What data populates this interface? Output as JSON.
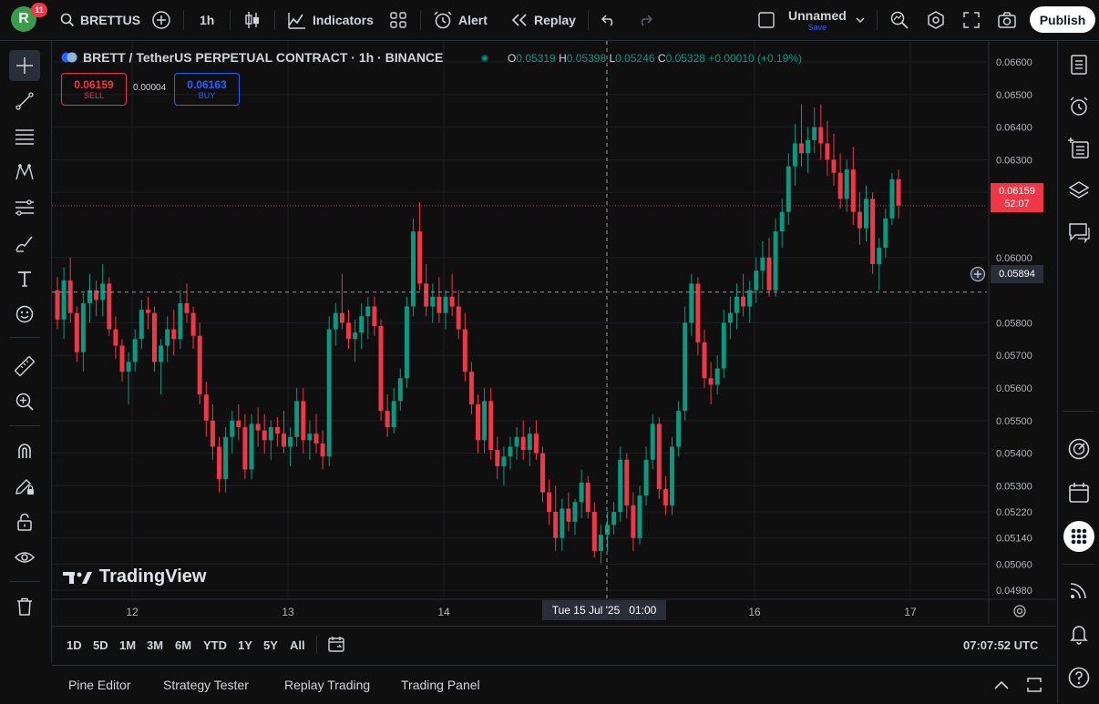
{
  "topbar": {
    "avatar_letter": "R",
    "notifications": "11",
    "symbol": "BRETTUS",
    "interval": "1h",
    "indicators_label": "Indicators",
    "alert_label": "Alert",
    "replay_label": "Replay",
    "layout_name": "Unnamed",
    "layout_status": "Save",
    "publish_label": "Publish"
  },
  "legend": {
    "title": "BRETT / TetherUS PERPETUAL CONTRACT · 1h · BINANCE",
    "o_label": "O",
    "o": "0.05319",
    "h_label": "H",
    "h": "0.05398",
    "l_label": "L",
    "l": "0.05246",
    "c_label": "C",
    "c": "0.05328",
    "change": "+0.00010 (+0.19%)"
  },
  "trade": {
    "sell_price": "0.06159",
    "sell_label": "SELL",
    "spread": "0.00004",
    "buy_price": "0.06163",
    "buy_label": "BUY"
  },
  "price_axis": {
    "ticks": [
      "0.06600",
      "0.06500",
      "0.06400",
      "0.06300",
      "0.06200",
      "0.06000",
      "0.05800",
      "0.05700",
      "0.05600",
      "0.05500",
      "0.05400",
      "0.05300",
      "0.05220",
      "0.05140",
      "0.05060",
      "0.04980"
    ],
    "last_price": "0.06159",
    "countdown": "52:07",
    "crosshair_price": "0.05894"
  },
  "time_axis": {
    "ticks": [
      "12",
      "13",
      "14",
      "16",
      "17"
    ],
    "crosshair_label": "Tue 15 Jul '25   01:00"
  },
  "watermark": "TradingView",
  "timeframes": [
    "1D",
    "5D",
    "1M",
    "3M",
    "6M",
    "YTD",
    "1Y",
    "5Y",
    "All"
  ],
  "clock": "07:07:52 UTC",
  "panels": [
    "Pine Editor",
    "Strategy Tester",
    "Replay Trading",
    "Trading Panel"
  ],
  "colors": {
    "up": "#089981",
    "down": "#f23645",
    "accent": "#2962ff",
    "background": "#0f0f0f"
  },
  "chart_data": {
    "type": "candlestick",
    "symbol": "BRETT / TetherUS PERPETUAL CONTRACT",
    "interval": "1h",
    "exchange": "BINANCE",
    "x_tick_labels": [
      "12",
      "13",
      "14",
      "16",
      "17"
    ],
    "ylim": [
      0.0494,
      0.0666
    ],
    "y_ticks": [
      0.066,
      0.065,
      0.064,
      0.063,
      0.062,
      0.06,
      0.058,
      0.057,
      0.056,
      0.055,
      0.054,
      0.053,
      0.0522,
      0.0514,
      0.0506,
      0.0498
    ],
    "last_price": 0.06159,
    "crosshair_price": 0.05894,
    "ohlc": [
      [
        0.059,
        0.0594,
        0.0578,
        0.0581
      ],
      [
        0.0581,
        0.0597,
        0.0575,
        0.0593
      ],
      [
        0.0593,
        0.06,
        0.058,
        0.0583
      ],
      [
        0.0583,
        0.0585,
        0.0568,
        0.0571
      ],
      [
        0.0571,
        0.0589,
        0.0565,
        0.0586
      ],
      [
        0.0586,
        0.0595,
        0.058,
        0.059
      ],
      [
        0.059,
        0.0593,
        0.0582,
        0.0587
      ],
      [
        0.0587,
        0.0598,
        0.0582,
        0.0592
      ],
      [
        0.0592,
        0.0594,
        0.0576,
        0.0578
      ],
      [
        0.0578,
        0.0582,
        0.0569,
        0.0573
      ],
      [
        0.0573,
        0.0575,
        0.0562,
        0.0565
      ],
      [
        0.0565,
        0.0571,
        0.0555,
        0.0568
      ],
      [
        0.0568,
        0.0578,
        0.0565,
        0.0575
      ],
      [
        0.0575,
        0.0587,
        0.0572,
        0.0584
      ],
      [
        0.0584,
        0.0588,
        0.0578,
        0.0583
      ],
      [
        0.0583,
        0.0585,
        0.0565,
        0.0568
      ],
      [
        0.0568,
        0.0575,
        0.0558,
        0.0573
      ],
      [
        0.0573,
        0.0582,
        0.0568,
        0.0578
      ],
      [
        0.0578,
        0.0584,
        0.057,
        0.0575
      ],
      [
        0.0575,
        0.059,
        0.0572,
        0.0586
      ],
      [
        0.0586,
        0.0592,
        0.058,
        0.0583
      ],
      [
        0.0583,
        0.0585,
        0.0572,
        0.0576
      ],
      [
        0.0576,
        0.058,
        0.0555,
        0.0558
      ],
      [
        0.0558,
        0.0562,
        0.0545,
        0.055
      ],
      [
        0.055,
        0.0555,
        0.0538,
        0.0542
      ],
      [
        0.0542,
        0.0545,
        0.0528,
        0.0532
      ],
      [
        0.0532,
        0.0548,
        0.0528,
        0.0545
      ],
      [
        0.0545,
        0.0553,
        0.054,
        0.055
      ],
      [
        0.055,
        0.0555,
        0.0544,
        0.0548
      ],
      [
        0.0548,
        0.0552,
        0.0532,
        0.0535
      ],
      [
        0.0535,
        0.0552,
        0.0532,
        0.0549
      ],
      [
        0.0549,
        0.0554,
        0.0542,
        0.0547
      ],
      [
        0.0547,
        0.0552,
        0.054,
        0.0544
      ],
      [
        0.0544,
        0.055,
        0.0538,
        0.0548
      ],
      [
        0.0548,
        0.0551,
        0.0542,
        0.0546
      ],
      [
        0.0546,
        0.0553,
        0.054,
        0.0542
      ],
      [
        0.0542,
        0.0548,
        0.0536,
        0.0545
      ],
      [
        0.0545,
        0.056,
        0.0542,
        0.0556
      ],
      [
        0.0556,
        0.056,
        0.054,
        0.0544
      ],
      [
        0.0544,
        0.055,
        0.0538,
        0.0546
      ],
      [
        0.0546,
        0.0552,
        0.054,
        0.0543
      ],
      [
        0.0543,
        0.0547,
        0.0535,
        0.0539
      ],
      [
        0.0539,
        0.0582,
        0.0536,
        0.0578
      ],
      [
        0.0578,
        0.0586,
        0.0573,
        0.0583
      ],
      [
        0.0583,
        0.0595,
        0.0578,
        0.058
      ],
      [
        0.058,
        0.0584,
        0.0572,
        0.0575
      ],
      [
        0.0575,
        0.0581,
        0.0568,
        0.0577
      ],
      [
        0.0577,
        0.0586,
        0.0572,
        0.0582
      ],
      [
        0.0582,
        0.0588,
        0.0575,
        0.0585
      ],
      [
        0.0585,
        0.0588,
        0.0576,
        0.0579
      ],
      [
        0.0579,
        0.0581,
        0.055,
        0.0553
      ],
      [
        0.0553,
        0.0558,
        0.0545,
        0.0548
      ],
      [
        0.0548,
        0.056,
        0.0546,
        0.0556
      ],
      [
        0.0556,
        0.0566,
        0.0553,
        0.0563
      ],
      [
        0.0563,
        0.0588,
        0.056,
        0.0585
      ],
      [
        0.0585,
        0.0612,
        0.0582,
        0.0608
      ],
      [
        0.0608,
        0.0617,
        0.059,
        0.0592
      ],
      [
        0.0592,
        0.0598,
        0.0582,
        0.0585
      ],
      [
        0.0585,
        0.0592,
        0.058,
        0.0588
      ],
      [
        0.0588,
        0.0594,
        0.058,
        0.0583
      ],
      [
        0.0583,
        0.059,
        0.0578,
        0.0588
      ],
      [
        0.0588,
        0.0595,
        0.0582,
        0.0585
      ],
      [
        0.0585,
        0.059,
        0.0575,
        0.0578
      ],
      [
        0.0578,
        0.0583,
        0.0562,
        0.0565
      ],
      [
        0.0565,
        0.0568,
        0.0552,
        0.0555
      ],
      [
        0.0555,
        0.0558,
        0.054,
        0.0544
      ],
      [
        0.0544,
        0.056,
        0.054,
        0.0556
      ],
      [
        0.0556,
        0.056,
        0.0538,
        0.0541
      ],
      [
        0.0541,
        0.0545,
        0.0532,
        0.0536
      ],
      [
        0.0536,
        0.0542,
        0.053,
        0.0539
      ],
      [
        0.0539,
        0.0545,
        0.0535,
        0.0542
      ],
      [
        0.0542,
        0.0548,
        0.0538,
        0.0545
      ],
      [
        0.0545,
        0.055,
        0.0538,
        0.0541
      ],
      [
        0.0541,
        0.0548,
        0.0536,
        0.0546
      ],
      [
        0.0546,
        0.055,
        0.0538,
        0.054
      ],
      [
        0.054,
        0.0542,
        0.0525,
        0.0528
      ],
      [
        0.0528,
        0.0532,
        0.0518,
        0.0522
      ],
      [
        0.0522,
        0.053,
        0.051,
        0.0514
      ],
      [
        0.0514,
        0.0526,
        0.051,
        0.0523
      ],
      [
        0.0523,
        0.0528,
        0.0516,
        0.0519
      ],
      [
        0.0519,
        0.0526,
        0.0515,
        0.0525
      ],
      [
        0.0525,
        0.0535,
        0.052,
        0.0531
      ],
      [
        0.0531,
        0.0533,
        0.052,
        0.0522
      ],
      [
        0.0522,
        0.0525,
        0.0508,
        0.051
      ],
      [
        0.051,
        0.0518,
        0.0506,
        0.0515
      ],
      [
        0.0515,
        0.0522,
        0.051,
        0.0518
      ],
      [
        0.0518,
        0.0525,
        0.0515,
        0.0522
      ],
      [
        0.0522,
        0.0542,
        0.0519,
        0.0538
      ],
      [
        0.0538,
        0.054,
        0.052,
        0.0524
      ],
      [
        0.0524,
        0.0528,
        0.051,
        0.0514
      ],
      [
        0.0514,
        0.053,
        0.0512,
        0.0527
      ],
      [
        0.0527,
        0.0542,
        0.0524,
        0.0538
      ],
      [
        0.0538,
        0.0552,
        0.0535,
        0.0549
      ],
      [
        0.0549,
        0.0551,
        0.0526,
        0.0529
      ],
      [
        0.0529,
        0.0533,
        0.0521,
        0.0524
      ],
      [
        0.0524,
        0.0545,
        0.0521,
        0.0542
      ],
      [
        0.0542,
        0.0556,
        0.0539,
        0.0553
      ],
      [
        0.0553,
        0.0585,
        0.055,
        0.058
      ],
      [
        0.058,
        0.0595,
        0.0576,
        0.0592
      ],
      [
        0.0592,
        0.0594,
        0.057,
        0.0574
      ],
      [
        0.0574,
        0.0578,
        0.056,
        0.0563
      ],
      [
        0.0563,
        0.0568,
        0.0555,
        0.0561
      ],
      [
        0.0561,
        0.057,
        0.0558,
        0.0566
      ],
      [
        0.0566,
        0.0584,
        0.0563,
        0.058
      ],
      [
        0.058,
        0.0588,
        0.0575,
        0.0583
      ],
      [
        0.0583,
        0.0592,
        0.0578,
        0.0588
      ],
      [
        0.0588,
        0.0595,
        0.0582,
        0.0585
      ],
      [
        0.0585,
        0.0593,
        0.058,
        0.059
      ],
      [
        0.059,
        0.06,
        0.0586,
        0.0596
      ],
      [
        0.0596,
        0.0605,
        0.059,
        0.06
      ],
      [
        0.06,
        0.0606,
        0.0588,
        0.059
      ],
      [
        0.059,
        0.0612,
        0.0588,
        0.0608
      ],
      [
        0.0608,
        0.0618,
        0.0603,
        0.0614
      ],
      [
        0.0614,
        0.0632,
        0.061,
        0.0628
      ],
      [
        0.0628,
        0.0641,
        0.0622,
        0.0635
      ],
      [
        0.0635,
        0.0647,
        0.0628,
        0.0632
      ],
      [
        0.0632,
        0.064,
        0.0626,
        0.0636
      ],
      [
        0.0636,
        0.0646,
        0.0632,
        0.064
      ],
      [
        0.064,
        0.0647,
        0.063,
        0.0635
      ],
      [
        0.0635,
        0.0642,
        0.0625,
        0.063
      ],
      [
        0.063,
        0.0638,
        0.0622,
        0.0626
      ],
      [
        0.0626,
        0.0632,
        0.0615,
        0.0618
      ],
      [
        0.0618,
        0.063,
        0.0614,
        0.0627
      ],
      [
        0.0627,
        0.0634,
        0.061,
        0.0614
      ],
      [
        0.0614,
        0.062,
        0.0604,
        0.0609
      ],
      [
        0.0609,
        0.0622,
        0.0605,
        0.0618
      ],
      [
        0.0618,
        0.062,
        0.0595,
        0.0598
      ],
      [
        0.0598,
        0.0606,
        0.059,
        0.0603
      ],
      [
        0.0603,
        0.0615,
        0.06,
        0.0612
      ],
      [
        0.0612,
        0.0626,
        0.061,
        0.0624
      ],
      [
        0.0624,
        0.0627,
        0.0612,
        0.0616
      ]
    ]
  }
}
